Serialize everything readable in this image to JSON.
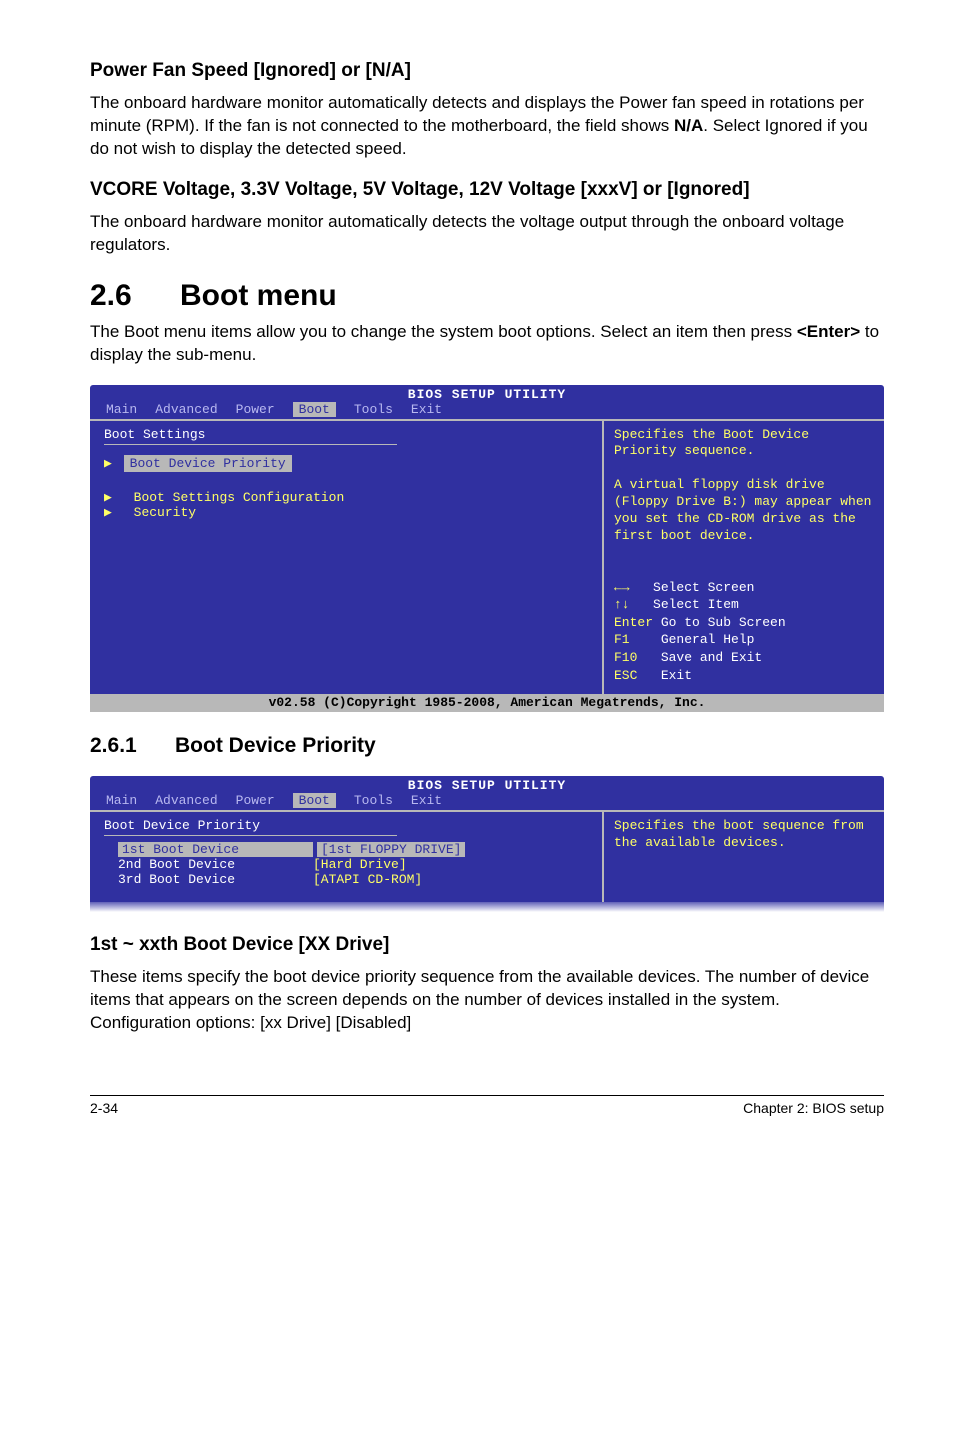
{
  "s1": {
    "h": "Power Fan Speed [Ignored] or [N/A]",
    "p_a": "The onboard hardware monitor automatically detects and displays the Power fan speed in rotations per minute (RPM). If the fan is not connected to the motherboard, the field shows ",
    "p_bold": "N/A",
    "p_b": ". Select Ignored if you do not wish to display the detected speed."
  },
  "s2": {
    "h": " VCORE Voltage, 3.3V Voltage, 5V Voltage, 12V Voltage [xxxV] or [Ignored]",
    "p": "The onboard hardware monitor automatically detects the voltage output through the onboard voltage regulators."
  },
  "sec": {
    "num": "2.6",
    "title": "Boot menu",
    "p_a": "The Boot menu items allow you to change the system boot options. Select an item then press ",
    "p_bold": "<Enter>",
    "p_b": " to display the sub-menu."
  },
  "bios1": {
    "title": "BIOS SETUP UTILITY",
    "tabs": [
      "Main",
      "Advanced",
      "Power",
      "Boot",
      "Tools",
      "Exit"
    ],
    "active_tab": 3,
    "heading": "Boot Settings",
    "sel": "Boot Device Priority",
    "items": [
      "Boot Settings Configuration",
      "Security"
    ],
    "help": "Specifies the Boot Device Priority sequence.\n\nA virtual floppy disk drive (Floppy Drive B:) may appear when you set the CD-ROM drive as the first boot device.",
    "nav": [
      {
        "k": "←→",
        "v": "Select Screen"
      },
      {
        "k": "↑↓",
        "v": "Select Item"
      },
      {
        "k": "Enter",
        "v": "Go to Sub Screen"
      },
      {
        "k": "F1",
        "v": "General Help"
      },
      {
        "k": "F10",
        "v": "Save and Exit"
      },
      {
        "k": "ESC",
        "v": "Exit"
      }
    ],
    "footer": "v02.58 (C)Copyright 1985-2008, American Megatrends, Inc."
  },
  "subsec": {
    "num": "2.6.1",
    "title": "Boot Device Priority"
  },
  "bios2": {
    "title": "BIOS SETUP UTILITY",
    "tabs": [
      "Main",
      "Advanced",
      "Power",
      "Boot",
      "Tools",
      "Exit"
    ],
    "active_tab": 3,
    "heading": "Boot Device Priority",
    "rows": [
      {
        "k": "1st Boot Device",
        "v": "[1st FLOPPY DRIVE]",
        "sel": true
      },
      {
        "k": "2nd Boot Device",
        "v": "[Hard Drive]",
        "sel": false
      },
      {
        "k": "3rd Boot Device",
        "v": "[ATAPI CD-ROM]",
        "sel": false
      }
    ],
    "help": "Specifies the boot sequence from the available devices."
  },
  "s3": {
    "h": "1st ~ xxth Boot Device [XX Drive]",
    "p": "These items specify the boot device priority sequence from the available devices. The number of device items that appears on the screen depends on the number of devices installed in the system. Configuration options: [xx Drive] [Disabled]"
  },
  "footer": {
    "left": "2-34",
    "right": "Chapter 2: BIOS setup"
  }
}
